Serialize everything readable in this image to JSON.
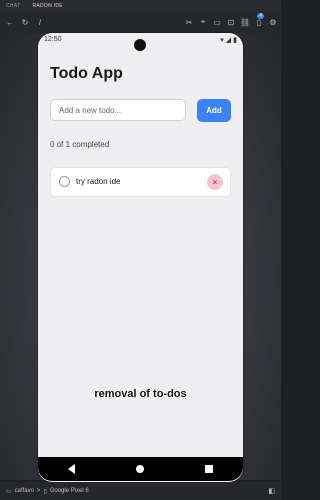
{
  "ide": {
    "tabs": [
      "CHAT",
      "RADON IDE"
    ],
    "toolbar": {
      "left_icons": [
        "back-arrow-icon",
        "reload-icon",
        "slash-icon"
      ],
      "path_text": "/",
      "badge": "4"
    },
    "status": {
      "project": "caffavo",
      "separator": ">",
      "device": "Google Pixel 8"
    }
  },
  "phone": {
    "time": "12:50",
    "status_icons": [
      "wifi-icon",
      "signal-icon",
      "battery-icon"
    ]
  },
  "app": {
    "title": "Todo App",
    "input_placeholder": "Add a new todo...",
    "add_label": "Add",
    "progress": "0 of 1 completed",
    "todos": [
      {
        "text": "try radon ide",
        "completed": false
      }
    ],
    "delete_symbol": "×"
  },
  "caption": "removal of to-dos",
  "colors": {
    "accent": "#3b82f6",
    "delete_bg": "#f6c7cc",
    "delete_fg": "#d13b4a"
  }
}
